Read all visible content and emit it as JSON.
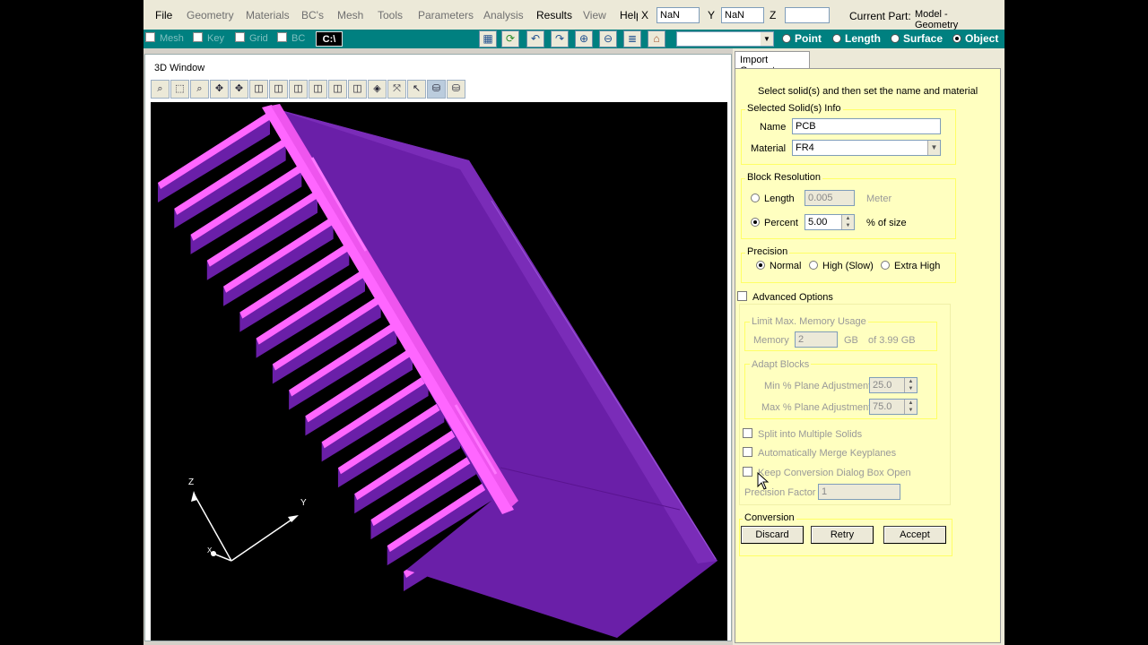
{
  "menu": [
    "File",
    "Geometry",
    "Materials",
    "BC's",
    "Mesh",
    "Tools",
    "Parameters",
    "Analysis",
    "Results",
    "View",
    "Help"
  ],
  "coords": {
    "x_label": "X",
    "x_value": "NaN",
    "y_label": "Y",
    "y_value": "NaN",
    "z_label": "Z",
    "z_value": ""
  },
  "current_part": {
    "label": "Current Part:",
    "value": "Model - Geometry"
  },
  "toolbar": {
    "checks": [
      "Mesh",
      "Key",
      "Grid",
      "BC"
    ],
    "console_label": "C:\\",
    "radios": [
      {
        "label": "Point",
        "selected": false
      },
      {
        "label": "Length",
        "selected": false
      },
      {
        "label": "Surface",
        "selected": false
      },
      {
        "label": "Object",
        "selected": true
      }
    ]
  },
  "window3d": {
    "title": "3D Window",
    "axes": {
      "z": "Z",
      "y": "Y",
      "x": "X"
    }
  },
  "panel": {
    "tab": "Import Geometry",
    "instruction": "Select solid(s) and then set the name and material",
    "selected": {
      "title": "Selected Solid(s) Info",
      "name_label": "Name",
      "name_value": "PCB",
      "material_label": "Material",
      "material_value": "FR4"
    },
    "resolution": {
      "title": "Block Resolution",
      "length_label": "Length",
      "length_value": "0.005",
      "length_unit": "Meter",
      "percent_label": "Percent",
      "percent_value": "5.00",
      "percent_unit": "% of size"
    },
    "precision": {
      "title": "Precision",
      "options": [
        "Normal",
        "High (Slow)",
        "Extra High"
      ]
    },
    "advanced": {
      "label": "Advanced Options",
      "memory": {
        "title": "Limit Max. Memory Usage",
        "label": "Memory",
        "value": "2",
        "unit": "GB",
        "of": "of 3.99 GB"
      },
      "adapt": {
        "title": "Adapt Blocks",
        "min_label": "Min % Plane Adjustment",
        "min_value": "25.0",
        "max_label": "Max % Plane Adjustment",
        "max_value": "75.0"
      },
      "checks": [
        "Split into Multiple Solids",
        "Automatically Merge Keyplanes",
        "Keep Conversion Dialog Box Open"
      ],
      "precision_factor_label": "Precision Factor",
      "precision_factor_value": "1"
    },
    "conversion": {
      "title": "Conversion",
      "discard": "Discard",
      "retry": "Retry",
      "accept": "Accept"
    }
  }
}
